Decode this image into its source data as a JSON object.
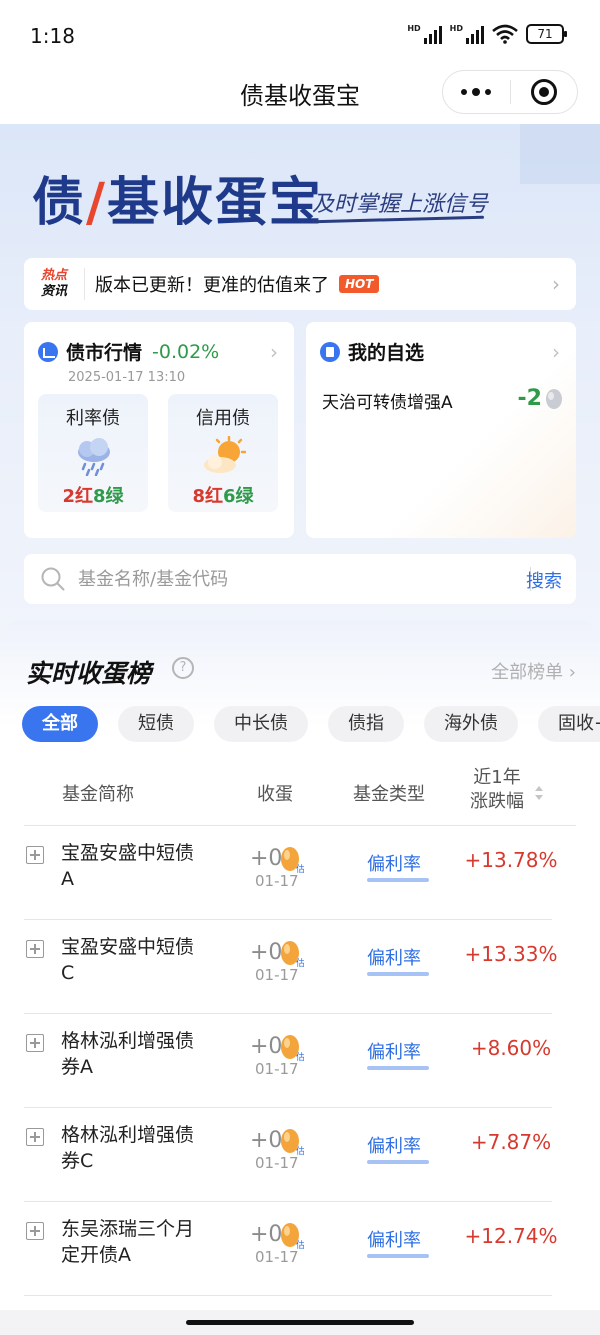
{
  "status_bar": {
    "time": "1:18",
    "signal1": "HD",
    "signal2": "HD",
    "battery": "71"
  },
  "title_bar": {
    "title": "债基收蛋宝"
  },
  "hero": {
    "logo_part1": "债",
    "logo_part2": "基收蛋宝",
    "slogan": "及时掌握上涨信号"
  },
  "news": {
    "tag_line1": "热点",
    "tag_line2": "资讯",
    "text": "版本已更新！更准的估值来了",
    "badge": "HOT"
  },
  "market": {
    "title": "债市行情",
    "change": "-0.02%",
    "time": "2025-01-17 13:10",
    "items": [
      {
        "name": "利率债",
        "red": "2红",
        "green": "8绿",
        "weather": "rain"
      },
      {
        "name": "信用债",
        "red": "8红",
        "green": "6绿",
        "weather": "sun-cloud"
      }
    ]
  },
  "favorites": {
    "title": "我的自选",
    "fund": "天治可转债增强A",
    "value": "-2"
  },
  "search": {
    "placeholder": "基金名称/基金代码",
    "button": "搜索"
  },
  "ranking": {
    "title": "实时收蛋榜",
    "all_link": "全部榜单 ›",
    "chips": [
      "全部",
      "短债",
      "中长债",
      "债指",
      "海外债",
      "固收+"
    ],
    "headers": {
      "name": "基金简称",
      "eggs": "收蛋",
      "type": "基金类型",
      "change_line1": "近1年",
      "change_line2": "涨跌幅"
    },
    "rows": [
      {
        "name": "宝盈安盛中短债A",
        "eggs": "+0",
        "date": "01-17",
        "type": "偏利率",
        "change": "+13.78%"
      },
      {
        "name": "宝盈安盛中短债C",
        "eggs": "+0",
        "date": "01-17",
        "type": "偏利率",
        "change": "+13.33%"
      },
      {
        "name": "格林泓利增强债券A",
        "eggs": "+0",
        "date": "01-17",
        "type": "偏利率",
        "change": "+8.60%"
      },
      {
        "name": "格林泓利增强债券C",
        "eggs": "+0",
        "date": "01-17",
        "type": "偏利率",
        "change": "+7.87%"
      },
      {
        "name": "东吴添瑞三个月定开债A",
        "eggs": "+0",
        "date": "01-17",
        "type": "偏利率",
        "change": "+12.74%"
      }
    ]
  },
  "colors": {
    "accent": "#3a75f0",
    "up": "#d63a2f",
    "down": "#2e9a4a"
  }
}
